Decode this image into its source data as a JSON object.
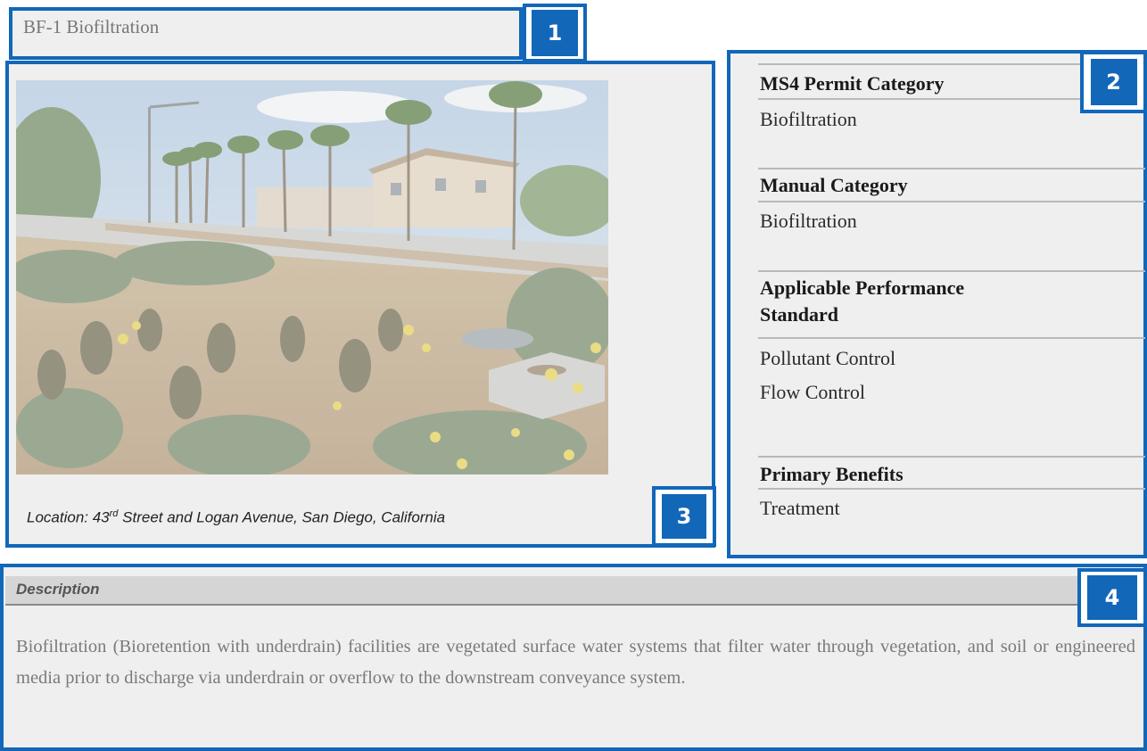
{
  "title": "BF-1 Biofiltration",
  "badges": {
    "one": "1",
    "two": "2",
    "three": "3",
    "four": "4"
  },
  "photo": {
    "caption_prefix": "Location: 43",
    "caption_sup": "rd",
    "caption_suffix": " Street and Logan Avenue, San Diego, California"
  },
  "info": {
    "permit_heading": "MS4 Permit Category",
    "permit_value": "Biofiltration",
    "manual_heading": "Manual Category",
    "manual_value": "Biofiltration",
    "performance_heading_line1": "Applicable Performance",
    "performance_heading_line2": "Standard",
    "performance_value_1": "Pollutant Control",
    "performance_value_2": "Flow Control",
    "benefits_heading": "Primary Benefits",
    "benefits_value": "Treatment"
  },
  "description": {
    "heading": "Description",
    "body": "Biofiltration (Bioretention with underdrain) facilities are vegetated surface water systems that filter water through vegetation, and soil or engineered media prior to discharge via underdrain or overflow to the downstream conveyance system."
  },
  "colors": {
    "frame_blue": "#1267b9",
    "panel_gray": "#efefef"
  }
}
